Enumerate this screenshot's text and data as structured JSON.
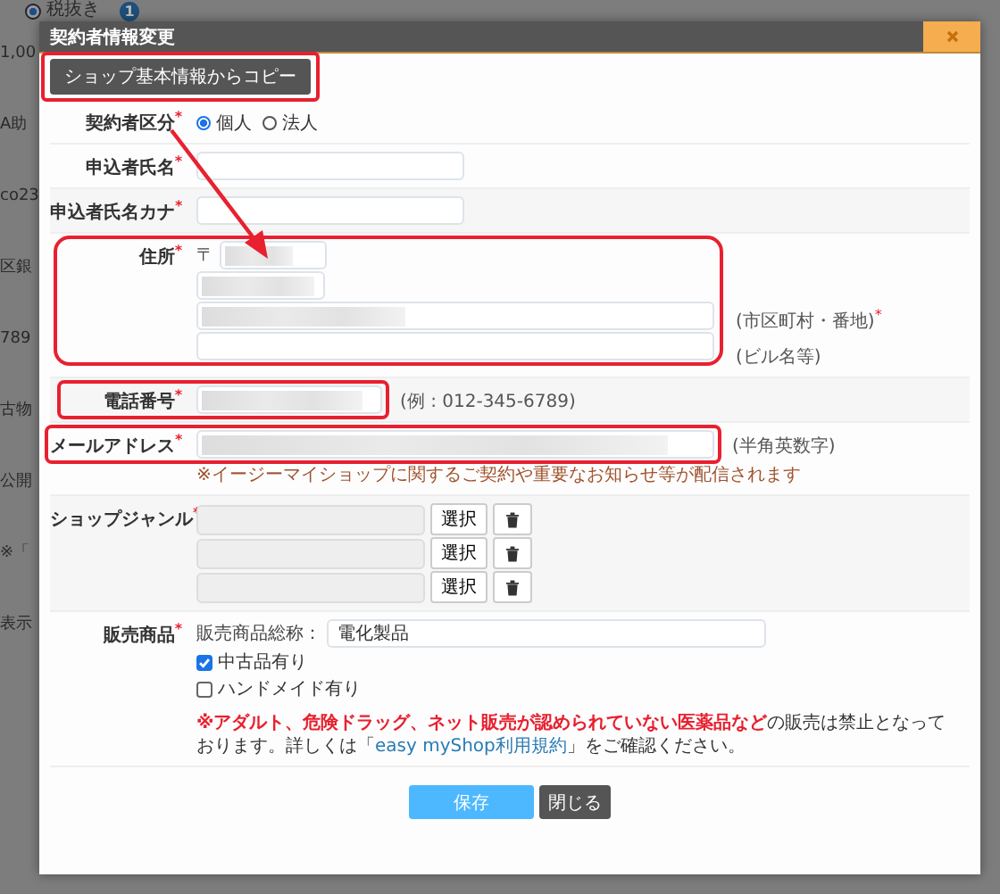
{
  "background": {
    "top_radio": {
      "label": "税抜き",
      "selected": true
    },
    "info_badge": "1",
    "left_texts": [
      "1,00",
      "A助",
      "co23",
      "区銀",
      "789",
      "古物",
      "公開",
      "※「",
      "表示"
    ]
  },
  "dialog": {
    "title": "契約者情報変更",
    "pointer_arrow": true,
    "copy_button": {
      "label": "ショップ基本情報からコピー",
      "highlighted": true
    },
    "rows": [
      {
        "kind": "radio",
        "label": "契約者区分",
        "mark": "*",
        "highlighted": false,
        "options": [
          {
            "label": "個人",
            "selected": true
          },
          {
            "label": "法人",
            "selected": false
          }
        ]
      },
      {
        "kind": "text",
        "label": "申込者氏名",
        "mark": "*",
        "highlighted": false
      },
      {
        "kind": "text",
        "label": "申込者氏名カナ",
        "mark": "*",
        "highlighted": false
      },
      {
        "kind": "address",
        "label": "住所",
        "mark": "*",
        "highlighted": true,
        "postal_prefix": "〒",
        "blurred": true,
        "lines": [
          {
            "hint": "(市区町村・番地)",
            "mark": "*",
            "blurred": true
          },
          {
            "hint": "(ビル名等)",
            "blurred": false
          }
        ]
      },
      {
        "kind": "phone",
        "label": "電話番号",
        "mark": "*",
        "highlighted": true,
        "blurred": true,
        "hint": "(例 : 012-345-6789)"
      },
      {
        "kind": "email",
        "label": "メールアドレス",
        "mark": "*",
        "highlighted": true,
        "blurred": true,
        "hint": "(半角英数字)",
        "note": "※イージーマイショップに関するご契約や重要なお知らせ等が配信されます"
      },
      {
        "kind": "genre",
        "label": "ショップジャンル",
        "mark": "*",
        "highlighted": false,
        "slots": [
          {
            "button": "選択"
          },
          {
            "button": "選択"
          },
          {
            "button": "選択"
          }
        ]
      },
      {
        "kind": "products",
        "label": "販売商品",
        "mark": "*",
        "highlighted": false,
        "name_label": "販売商品総称：",
        "name_value": "電化製品",
        "options": [
          {
            "label": "中古品有り",
            "checked": true
          },
          {
            "label": "ハンドメイド有り",
            "checked": false
          }
        ],
        "notice": {
          "warning": "※アダルト、危険ドラッグ、ネット販売が認められていない医薬品など",
          "text": "の販売は禁止となっております。詳しくは「",
          "link": "easy myShop利用規約",
          "tail": "」をご確認ください。"
        }
      }
    ],
    "footer": {
      "save": "保存",
      "close": "閉じる"
    }
  }
}
